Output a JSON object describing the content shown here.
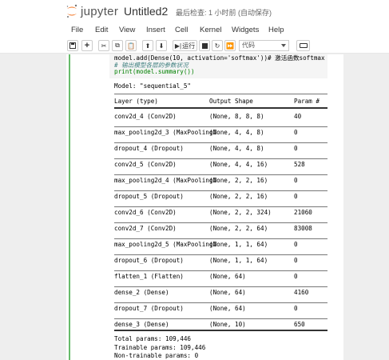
{
  "header": {
    "logo_text": "jupyter",
    "notebook_title": "Untitled2",
    "checkpoint": "最后检查: 1 小时前  (自动保存)"
  },
  "menu": [
    "File",
    "Edit",
    "View",
    "Insert",
    "Cell",
    "Kernel",
    "Widgets",
    "Help"
  ],
  "toolbar": {
    "run_label": "运行",
    "cell_type": "代码"
  },
  "code": {
    "line1": "model.add(Dense(10, activation='softmax'))# 激活函数softmax",
    "line2": "# 输出模型各层的参数状况",
    "line3": "print(model.summary())"
  },
  "summary": {
    "model_line": "Model: \"sequential_5\"",
    "headers": [
      "Layer (type)",
      "Output Shape",
      "Param #"
    ],
    "rows": [
      [
        "conv2d_4 (Conv2D)",
        "(None, 8, 8, 8)",
        "40"
      ],
      [
        "max_pooling2d_3 (MaxPooling2",
        "(None, 4, 4, 8)",
        "0"
      ],
      [
        "dropout_4 (Dropout)",
        "(None, 4, 4, 8)",
        "0"
      ],
      [
        "conv2d_5 (Conv2D)",
        "(None, 4, 4, 16)",
        "528"
      ],
      [
        "max_pooling2d_4 (MaxPooling2",
        "(None, 2, 2, 16)",
        "0"
      ],
      [
        "dropout_5 (Dropout)",
        "(None, 2, 2, 16)",
        "0"
      ],
      [
        "conv2d_6 (Conv2D)",
        "(None, 2, 2, 324)",
        "21060"
      ],
      [
        "conv2d_7 (Conv2D)",
        "(None, 2, 2, 64)",
        "83008"
      ],
      [
        "max_pooling2d_5 (MaxPooling2",
        "(None, 1, 1, 64)",
        "0"
      ],
      [
        "dropout_6 (Dropout)",
        "(None, 1, 1, 64)",
        "0"
      ],
      [
        "flatten_1 (Flatten)",
        "(None, 64)",
        "0"
      ],
      [
        "dense_2 (Dense)",
        "(None, 64)",
        "4160"
      ],
      [
        "dropout_7 (Dropout)",
        "(None, 64)",
        "0"
      ],
      [
        "dense_3 (Dense)",
        "(None, 10)",
        "650"
      ]
    ],
    "total": "Total params: 109,446",
    "trainable": "Trainable params: 109,446",
    "non_trainable": "Non-trainable params: 0"
  },
  "colors": {
    "accent_orange": "#f37726",
    "cell_green": "#66bb6a",
    "comment_color": "#408080",
    "keyword_color": "#008000",
    "string_color": "#ba2121"
  }
}
